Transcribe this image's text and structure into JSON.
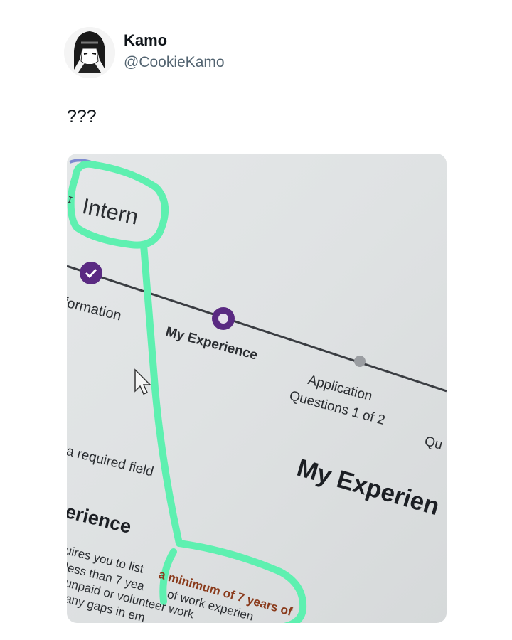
{
  "tweet": {
    "author_name": "Kamo",
    "author_handle": "@CookieKamo",
    "text": "???"
  },
  "photo": {
    "job_title": "Intern",
    "steps": [
      {
        "label": "formation",
        "state": "completed"
      },
      {
        "label": "My Experience",
        "state": "current"
      },
      {
        "label_line1": "Application",
        "label_line2": "Questions 1 of 2",
        "state": "upcoming"
      },
      {
        "label": "Qu",
        "state": "upcoming"
      }
    ],
    "required_note": "a required field",
    "page_heading": "My Experien",
    "section_heading": "erience",
    "body_lines": [
      "uires you to list",
      "a minimum of 7 years of",
      "less than 7 yea",
      "of work experien",
      "unpaid or volunteer work",
      "any gaps in em"
    ],
    "colors": {
      "accent_purple": "#5a2a82",
      "highlight_marker": "#5ef0b0",
      "highlighted_text": "#8a3b1c"
    }
  }
}
